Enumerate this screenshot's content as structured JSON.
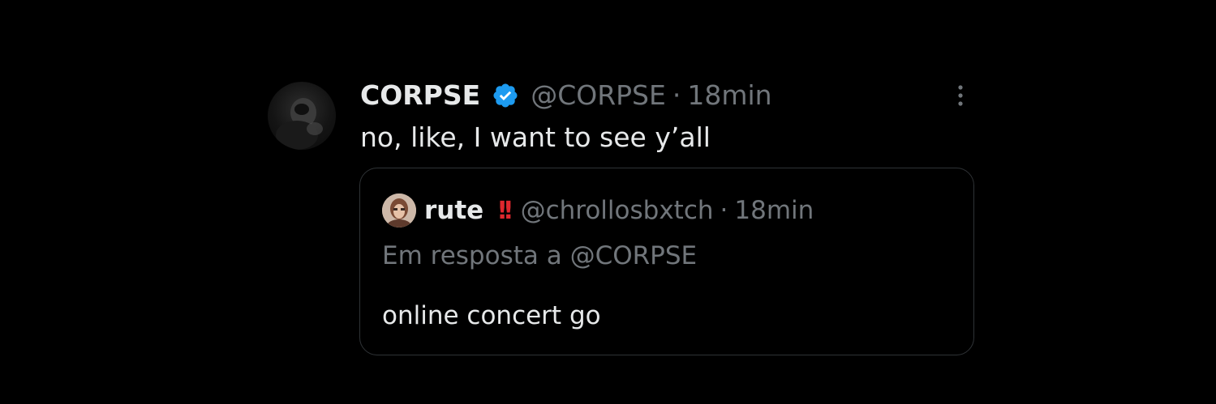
{
  "tweet": {
    "author": {
      "display_name": "CORPSE",
      "handle": "@CORPSE",
      "verified": true,
      "avatar_icon": "avatar-icon"
    },
    "separator": "·",
    "time": "18min",
    "text": "no, like, I want to see y’all",
    "more_icon": "more-vertical-icon"
  },
  "quote": {
    "author": {
      "display_name": "rute",
      "emoji": "!!",
      "handle": "@chrollosbxtch"
    },
    "separator": "·",
    "time": "18min",
    "reply_context": "Em resposta a @CORPSE",
    "text": "online concert go"
  },
  "colors": {
    "background": "#000000",
    "primary_text": "#e7e9ea",
    "secondary_text": "#71767b",
    "verified_blue": "#1d9bf0",
    "card_border": "#2f3336",
    "emoji_red": "#e0282e"
  }
}
